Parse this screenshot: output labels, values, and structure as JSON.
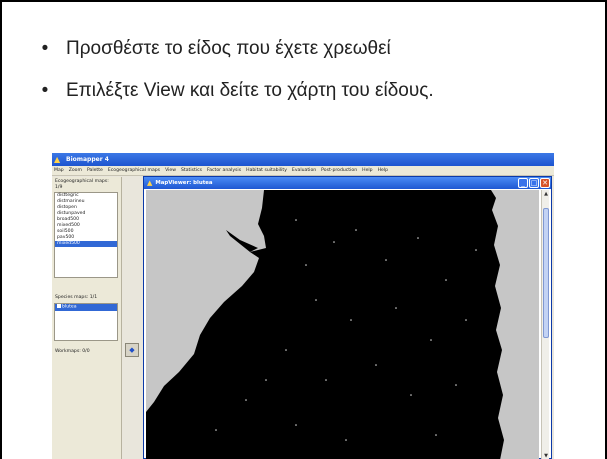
{
  "slide": {
    "bullets": [
      "Προσθέστε το είδος που έχετε χρεωθεί",
      "Επιλέξτε View και δείτε το χάρτη του είδους."
    ]
  },
  "app": {
    "title": "Biomapper 4",
    "menu": [
      "Map",
      "Zoom",
      "Palette",
      "Ecogeographical maps",
      "View",
      "Statistics",
      "Factor analysis",
      "Habitat suitability",
      "Evaluation",
      "Post-production",
      "Help",
      "Help"
    ],
    "ecogeo": {
      "label": "Ecogeographical maps: 1/9",
      "items": [
        "disttegric",
        "distmarineu",
        "distopen",
        "distunpaved",
        "broad500",
        "mixed500",
        "soil500",
        "pav500",
        "mixed500"
      ],
      "selected_index": 8
    },
    "species": {
      "label": "Species maps: 1/1",
      "items": [
        "blutea"
      ]
    },
    "workmaps": {
      "label": "Workmaps: 0/0"
    }
  },
  "viewer": {
    "title": "MapViewer: blutea",
    "buttons": {
      "minimize": "_",
      "maximize": "□",
      "close": "✕"
    }
  },
  "colors": {
    "map_background": "#c6c6c6",
    "map_region": "#000000",
    "titlebar": "#1e57d2",
    "selection": "#3168d5"
  }
}
